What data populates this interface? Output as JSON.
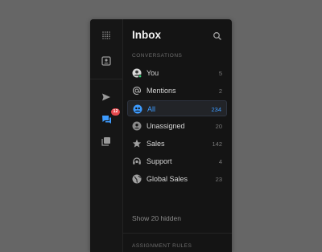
{
  "inbox": {
    "title": "Inbox",
    "section_conversations": "CONVERSATIONS",
    "items": [
      {
        "label": "You",
        "count": "5"
      },
      {
        "label": "Mentions",
        "count": "2"
      },
      {
        "label": "All",
        "count": "234"
      },
      {
        "label": "Unassigned",
        "count": "20"
      },
      {
        "label": "Sales",
        "count": "142"
      },
      {
        "label": "Support",
        "count": "4"
      },
      {
        "label": "Global Sales",
        "count": "23"
      }
    ],
    "show_hidden": "Show 20 hidden",
    "section_assignment": "ASSIGNMENT RULES"
  },
  "rail": {
    "badge": "12"
  },
  "colors": {
    "accent": "#3d9bff",
    "badge": "#e5484d",
    "background": "#141414"
  }
}
